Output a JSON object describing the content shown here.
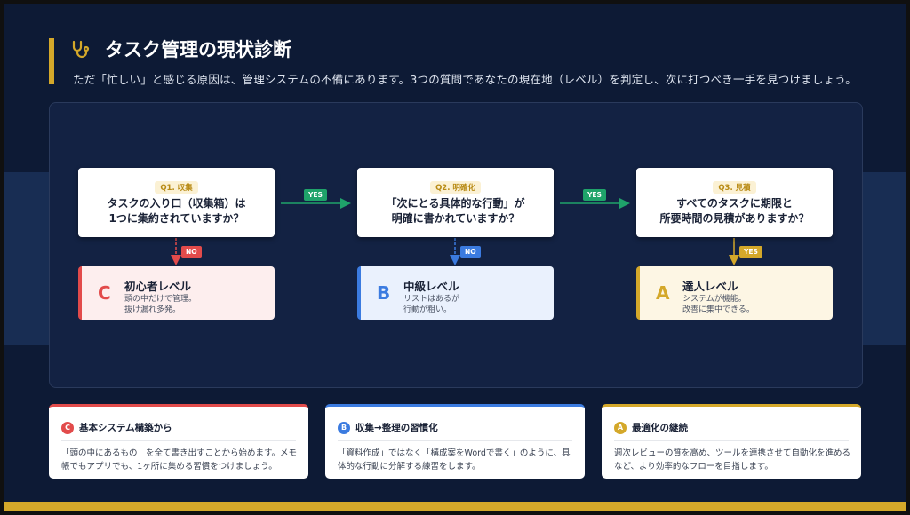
{
  "header": {
    "title": "タスク管理の現状診断",
    "subtitle": "ただ「忙しい」と感じる原因は、管理システムの不備にあります。3つの質問であなたの現在地（レベル）を判定し、次に打つべき一手を見つけましょう。",
    "icon": "stethoscope-icon",
    "accent_color": "#d4a82a"
  },
  "questions": [
    {
      "tag": "Q1. 収集",
      "text": "タスクの入り口（収集箱）は\n1つに集約されていますか？"
    },
    {
      "tag": "Q2. 明確化",
      "text": "「次にとる具体的な行動」が\n明確に書かれていますか？"
    },
    {
      "tag": "Q3. 見積",
      "text": "すべてのタスクに期限と\n所要時間の見積がありますか？"
    }
  ],
  "branch_labels": {
    "yes1": "YES",
    "yes2": "YES",
    "no1": "NO",
    "no2": "NO",
    "yes3": "YES"
  },
  "levels": [
    {
      "letter": "C",
      "title": "初心者レベル",
      "desc": "頭の中だけで管理。\n抜け漏れ多発。",
      "color": "#e24b4b"
    },
    {
      "letter": "B",
      "title": "中級レベル",
      "desc": "リストはあるが\n行動が粗い。",
      "color": "#3b7be0"
    },
    {
      "letter": "A",
      "title": "達人レベル",
      "desc": "システムが機能。\n改善に集中できる。",
      "color": "#d4a82a"
    }
  ],
  "actions": [
    {
      "letter": "C",
      "title": "基本システム構築から",
      "text": "「頭の中にあるもの」を全て書き出すことから始めます。メモ帳でもアプリでも、1ヶ所に集める習慣をつけましょう。"
    },
    {
      "letter": "B",
      "title": "収集→整理の習慣化",
      "text": "「資料作成」ではなく「構成案をWordで書く」のように、具体的な行動に分解する練習をします。"
    },
    {
      "letter": "A",
      "title": "最適化の継続",
      "text": "週次レビューの質を高め、ツールを連携させて自動化を進めるなど、より効率的なフローを目指します。"
    }
  ],
  "colors": {
    "background": "#0d1a35",
    "yes_green": "#1fa36a",
    "level_c": "#e24b4b",
    "level_b": "#3b7be0",
    "level_a": "#d4a82a"
  }
}
